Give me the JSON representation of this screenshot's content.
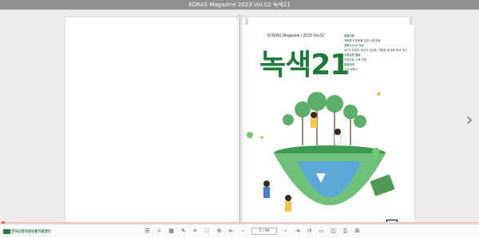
{
  "window": {
    "title": "KORAS Magazine 2023 Vol.02 녹색21"
  },
  "cover": {
    "masthead": "KORAS Magazine | 2023 Vol.02",
    "title": "녹색21",
    "toc": [
      {
        "heading": "특별기획",
        "line": "재활용 표준화를 통한 순환경제"
      },
      {
        "heading": "협회소식 & 이슈",
        "line": "제7차 환경부·생산자 간담회, 재활용 활성화 체계 개선"
      },
      {
        "heading": "사회공헌 활동",
        "line": "자원순환 교육 지원"
      },
      {
        "heading": "알림마당",
        "line": "신규 회원사"
      }
    ]
  },
  "footer": {
    "logo_text": "한국순환자원유통지원센터"
  },
  "toolbar": {
    "page_indicator": "5 / 96",
    "icons": [
      "menu-icon",
      "search-icon",
      "thumbnails-icon",
      "edit-icon",
      "link-icon",
      "zoom-fit-icon",
      "zoom-in-icon",
      "first-page-icon",
      "prev-page-icon",
      "next-page-icon",
      "last-page-icon",
      "reset-icon",
      "view-mode-icon",
      "double-page-icon",
      "print-icon",
      "close-icon"
    ]
  },
  "colors": {
    "brand_green": "#1f7a3a",
    "pager_accent": "#e05050"
  }
}
